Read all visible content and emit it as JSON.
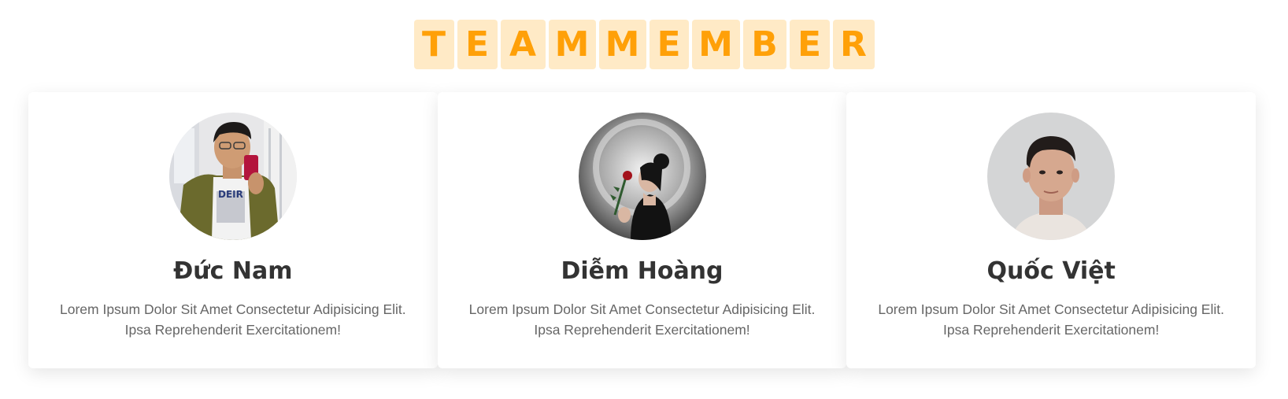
{
  "heading": {
    "letters": [
      "T",
      "E",
      "A",
      "M",
      "M",
      "E",
      "M",
      "B",
      "E",
      "R"
    ]
  },
  "members": [
    {
      "name": "Đức Nam",
      "description": "Lorem Ipsum Dolor Sit Amet Consectetur Adipisicing Elit. Ipsa Reprehenderit Exercitationem!"
    },
    {
      "name": "Diễm Hoàng",
      "description": "Lorem Ipsum Dolor Sit Amet Consectetur Adipisicing Elit. Ipsa Reprehenderit Exercitationem!"
    },
    {
      "name": "Quốc Việt",
      "description": "Lorem Ipsum Dolor Sit Amet Consectetur Adipisicing Elit. Ipsa Reprehenderit Exercitationem!"
    }
  ],
  "colors": {
    "accent": "#ffa008",
    "accent_bg": "#ffeac6"
  }
}
